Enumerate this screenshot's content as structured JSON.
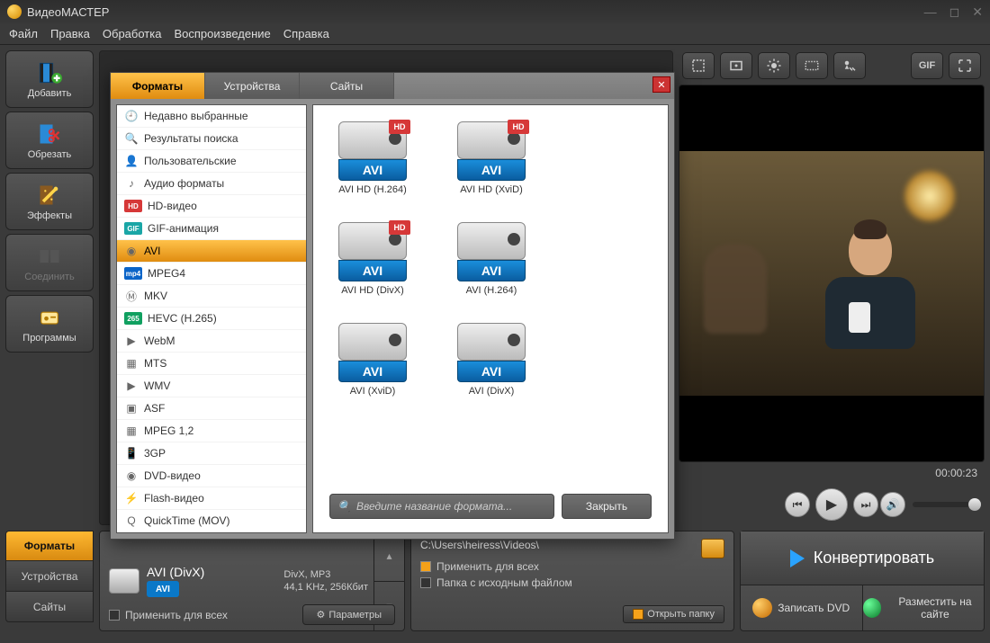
{
  "title": "ВидеоМАСТЕР",
  "menu": [
    "Файл",
    "Правка",
    "Обработка",
    "Воспроизведение",
    "Справка"
  ],
  "leftTools": [
    {
      "id": "add",
      "label": "Добавить"
    },
    {
      "id": "cut",
      "label": "Обрезать"
    },
    {
      "id": "fx",
      "label": "Эффекты"
    },
    {
      "id": "join",
      "label": "Соединить",
      "disabled": true
    },
    {
      "id": "prog",
      "label": "Программы"
    }
  ],
  "rightIcons": [
    "crop",
    "frame",
    "bright",
    "tile",
    "speed",
    "GIF",
    "full"
  ],
  "time": "00:00:23",
  "bottomTabs": [
    "Форматы",
    "Устройства",
    "Сайты"
  ],
  "format": {
    "name": "AVI (DivX)",
    "badge": "AVI",
    "line1": "DivX, MP3",
    "line2": "44,1 KHz, 256Кбит",
    "applyAll": "Применить для всех",
    "paramsBtn": "Параметры"
  },
  "path": {
    "value": "C:\\Users\\heiress\\Videos\\",
    "applyAll": "Применить для всех",
    "sourceFolder": "Папка с исходным файлом",
    "openFolder": "Открыть папку"
  },
  "actions": {
    "convert": "Конвертировать",
    "dvd": "Записать DVD",
    "web": "Разместить на сайте"
  },
  "popup": {
    "tabs": [
      "Форматы",
      "Устройства",
      "Сайты"
    ],
    "close": "✕",
    "side": [
      {
        "icon": "clock",
        "label": "Недавно выбранные"
      },
      {
        "icon": "search",
        "label": "Результаты поиска"
      },
      {
        "icon": "user",
        "label": "Пользовательские"
      },
      {
        "icon": "audio",
        "label": "Аудио форматы"
      },
      {
        "icon": "hd",
        "badge": "#d63838",
        "badgeText": "HD",
        "label": "HD-видео"
      },
      {
        "icon": "gif",
        "badge": "#1aa6a6",
        "badgeText": "GIF",
        "label": "GIF-анимация"
      },
      {
        "icon": "avi",
        "label": "AVI",
        "selected": true
      },
      {
        "icon": "mp4",
        "badge": "#0a64c8",
        "badgeText": "mp4",
        "label": "MPEG4"
      },
      {
        "icon": "mkv",
        "label": "MKV"
      },
      {
        "icon": "265",
        "badge": "#10a060",
        "badgeText": "265",
        "label": "HEVC (H.265)"
      },
      {
        "icon": "webm",
        "label": "WebM"
      },
      {
        "icon": "mts",
        "label": "MTS"
      },
      {
        "icon": "wmv",
        "label": "WMV"
      },
      {
        "icon": "asf",
        "label": "ASF"
      },
      {
        "icon": "mpeg",
        "label": "MPEG 1,2"
      },
      {
        "icon": "3gp",
        "label": "3GP"
      },
      {
        "icon": "dvd",
        "label": "DVD-видео"
      },
      {
        "icon": "flash",
        "label": "Flash-видео"
      },
      {
        "icon": "qt",
        "label": "QuickTime (MOV)"
      }
    ],
    "cards": [
      {
        "label": "AVI HD (H.264)",
        "hd": true
      },
      {
        "label": "AVI HD (XviD)",
        "hd": true
      },
      {
        "label": "AVI HD (DivX)",
        "hd": true
      },
      {
        "label": "AVI (H.264)"
      },
      {
        "label": "AVI (XviD)"
      },
      {
        "label": "AVI (DivX)"
      }
    ],
    "avitag": "AVI",
    "hdtag": "HD",
    "searchPlaceholder": "Введите название формата...",
    "closeBtn": "Закрыть"
  }
}
